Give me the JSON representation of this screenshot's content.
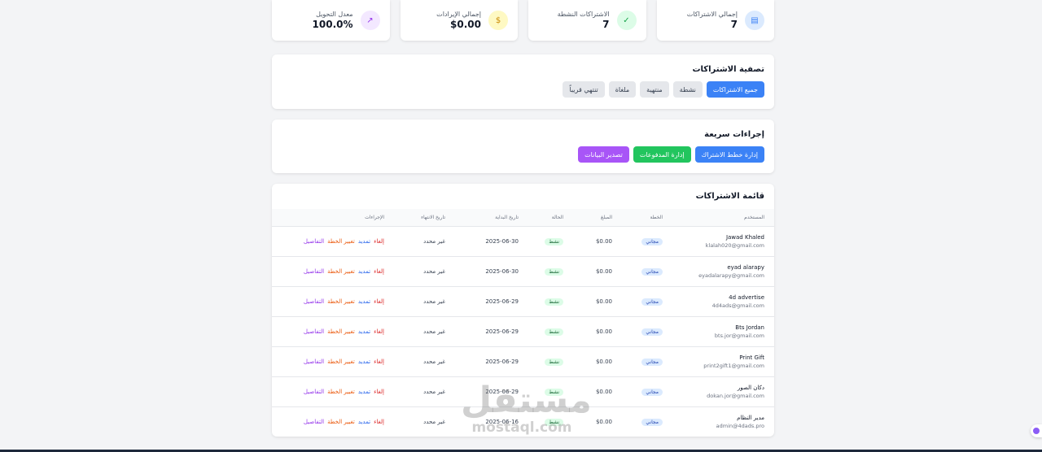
{
  "stats": [
    {
      "label": "إجمالي الاشتراكات",
      "value": "7",
      "icon": "document-icon",
      "bg": "#dbeafe",
      "fg": "#3b82f6"
    },
    {
      "label": "الاشتراكات النشطة",
      "value": "7",
      "icon": "check-circle-icon",
      "bg": "#dcfce7",
      "fg": "#16a34a"
    },
    {
      "label": "إجمالي الإيرادات",
      "value": "$0.00",
      "icon": "dollar-icon",
      "bg": "#fef9c3",
      "fg": "#ca8a04"
    },
    {
      "label": "معدل التحويل",
      "value": "100.0%",
      "icon": "trending-up-icon",
      "bg": "#f3e8ff",
      "fg": "#9333ea"
    }
  ],
  "filter": {
    "title": "تصفية الاشتراكات",
    "buttons": [
      "جميع الاشتراكات",
      "نشطة",
      "منتهية",
      "ملغاة",
      "تنتهي قريباً"
    ]
  },
  "quick": {
    "title": "إجراءات سريعة",
    "buttons": [
      "إدارة خطط الاشتراك",
      "إدارة المدفوعات",
      "تصدير البيانات"
    ]
  },
  "list": {
    "title": "قائمة الاشتراكات",
    "headers": [
      "المستخدم",
      "الخطة",
      "المبلغ",
      "الحالة",
      "تاريخ البداية",
      "تاريخ الانتهاء",
      "الإجراءات"
    ],
    "actions": {
      "cancel": "إلغاء",
      "renew": "تمديد",
      "change": "تغيير الخطة",
      "details": "التفاصيل"
    },
    "rows": [
      {
        "name": "Jawad Khaled",
        "email": "klalah020@gmail.com",
        "plan": "مجاني",
        "amount": "$0.00",
        "status": "نشط",
        "start": "2025-06-30",
        "end": "غير محدد"
      },
      {
        "name": "eyad alarapy",
        "email": "eyadalarapy@gmail.com",
        "plan": "مجاني",
        "amount": "$0.00",
        "status": "نشط",
        "start": "2025-06-30",
        "end": "غير محدد"
      },
      {
        "name": "4d advertise",
        "email": "4d4ads@gmail.com",
        "plan": "مجاني",
        "amount": "$0.00",
        "status": "نشط",
        "start": "2025-06-29",
        "end": "غير محدد"
      },
      {
        "name": "Bts Jordan",
        "email": "bts.jor@gmail.com",
        "plan": "مجاني",
        "amount": "$0.00",
        "status": "نشط",
        "start": "2025-06-29",
        "end": "غير محدد"
      },
      {
        "name": "Print Gift",
        "email": "print2gift1@gmail.com",
        "plan": "مجاني",
        "amount": "$0.00",
        "status": "نشط",
        "start": "2025-06-29",
        "end": "غير محدد"
      },
      {
        "name": "دكان الصور",
        "email": "dokan.jor@gmail.com",
        "plan": "مجاني",
        "amount": "$0.00",
        "status": "نشط",
        "start": "2025-06-29",
        "end": "غير محدد"
      },
      {
        "name": "مدير النظام",
        "email": "admin@4dads.pro",
        "plan": "مجاني",
        "amount": "$0.00",
        "status": "نشط",
        "start": "2025-06-16",
        "end": "غير محدد"
      }
    ]
  },
  "watermark": {
    "arabic": "مستقل",
    "latin": "mostaql.com"
  }
}
